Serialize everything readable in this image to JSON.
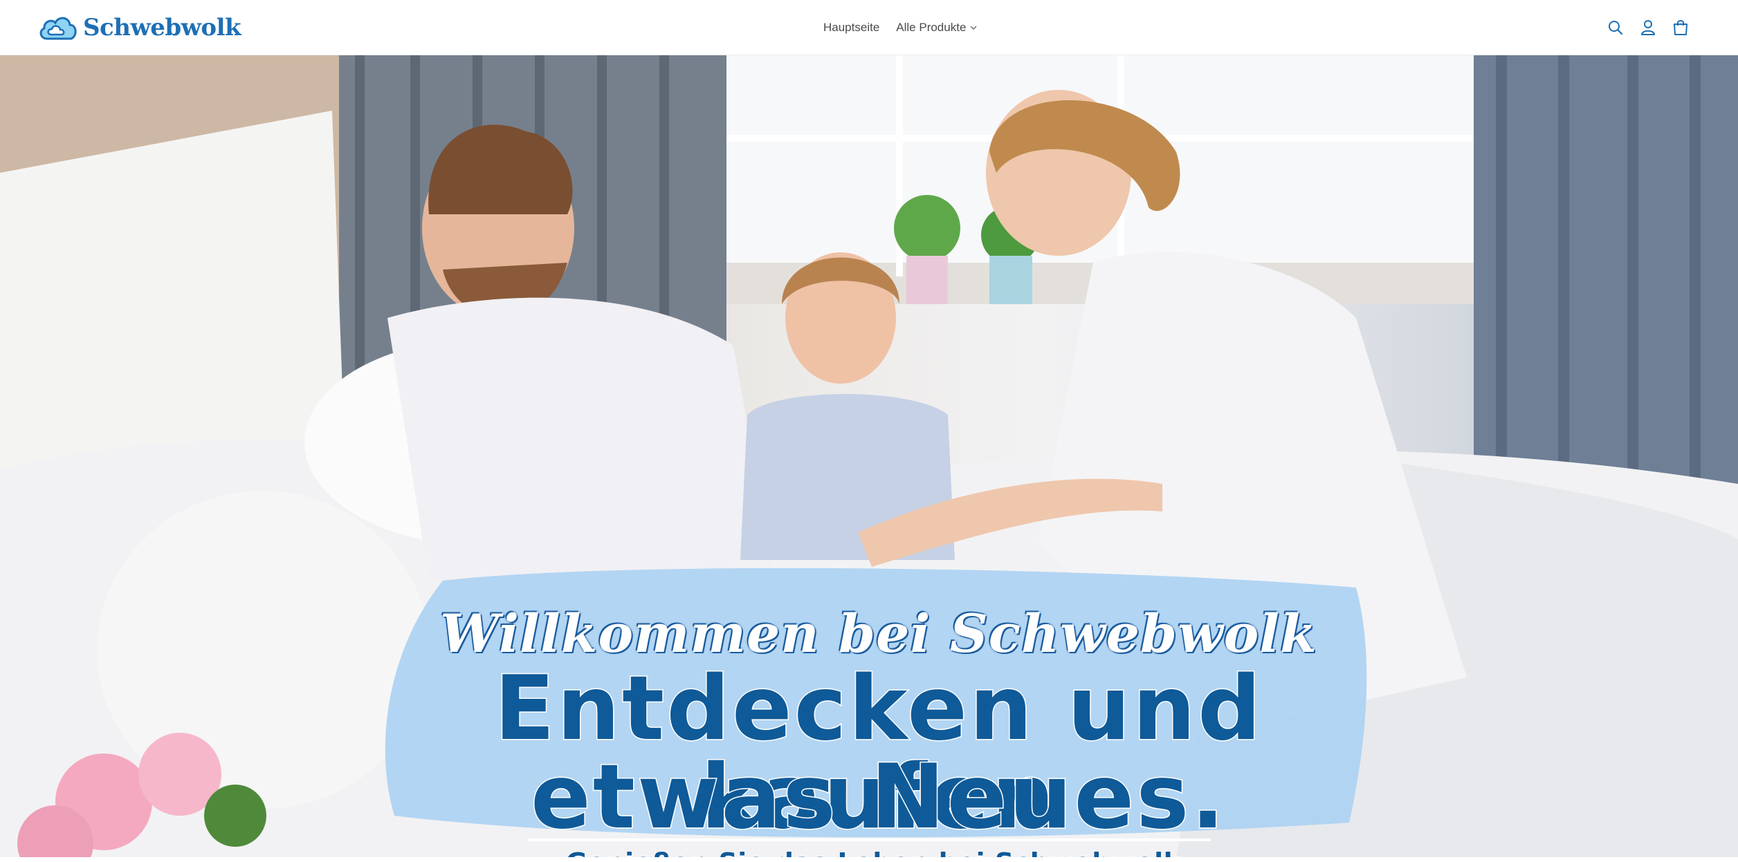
{
  "header": {
    "logo_text": "Schwebwolk",
    "nav": [
      {
        "label": "Hauptseite"
      },
      {
        "label": "Alle Produkte",
        "has_dropdown": true
      }
    ],
    "icons": [
      "search-icon",
      "account-icon",
      "cart-icon"
    ]
  },
  "hero": {
    "image_description_icon": "family-on-bed-photo",
    "welcome": "Willkommen bei Schwebwolk",
    "headline_line1": "Entdecken und kaufen",
    "headline_line2": "etwas Neues.",
    "tagline": "Genießen Sie das Leben bei Schwebwolk."
  },
  "colors": {
    "brand_blue": "#1d6fb5",
    "headline_blue": "#0f5a98",
    "banner_light_blue": "#a9d0f2"
  }
}
